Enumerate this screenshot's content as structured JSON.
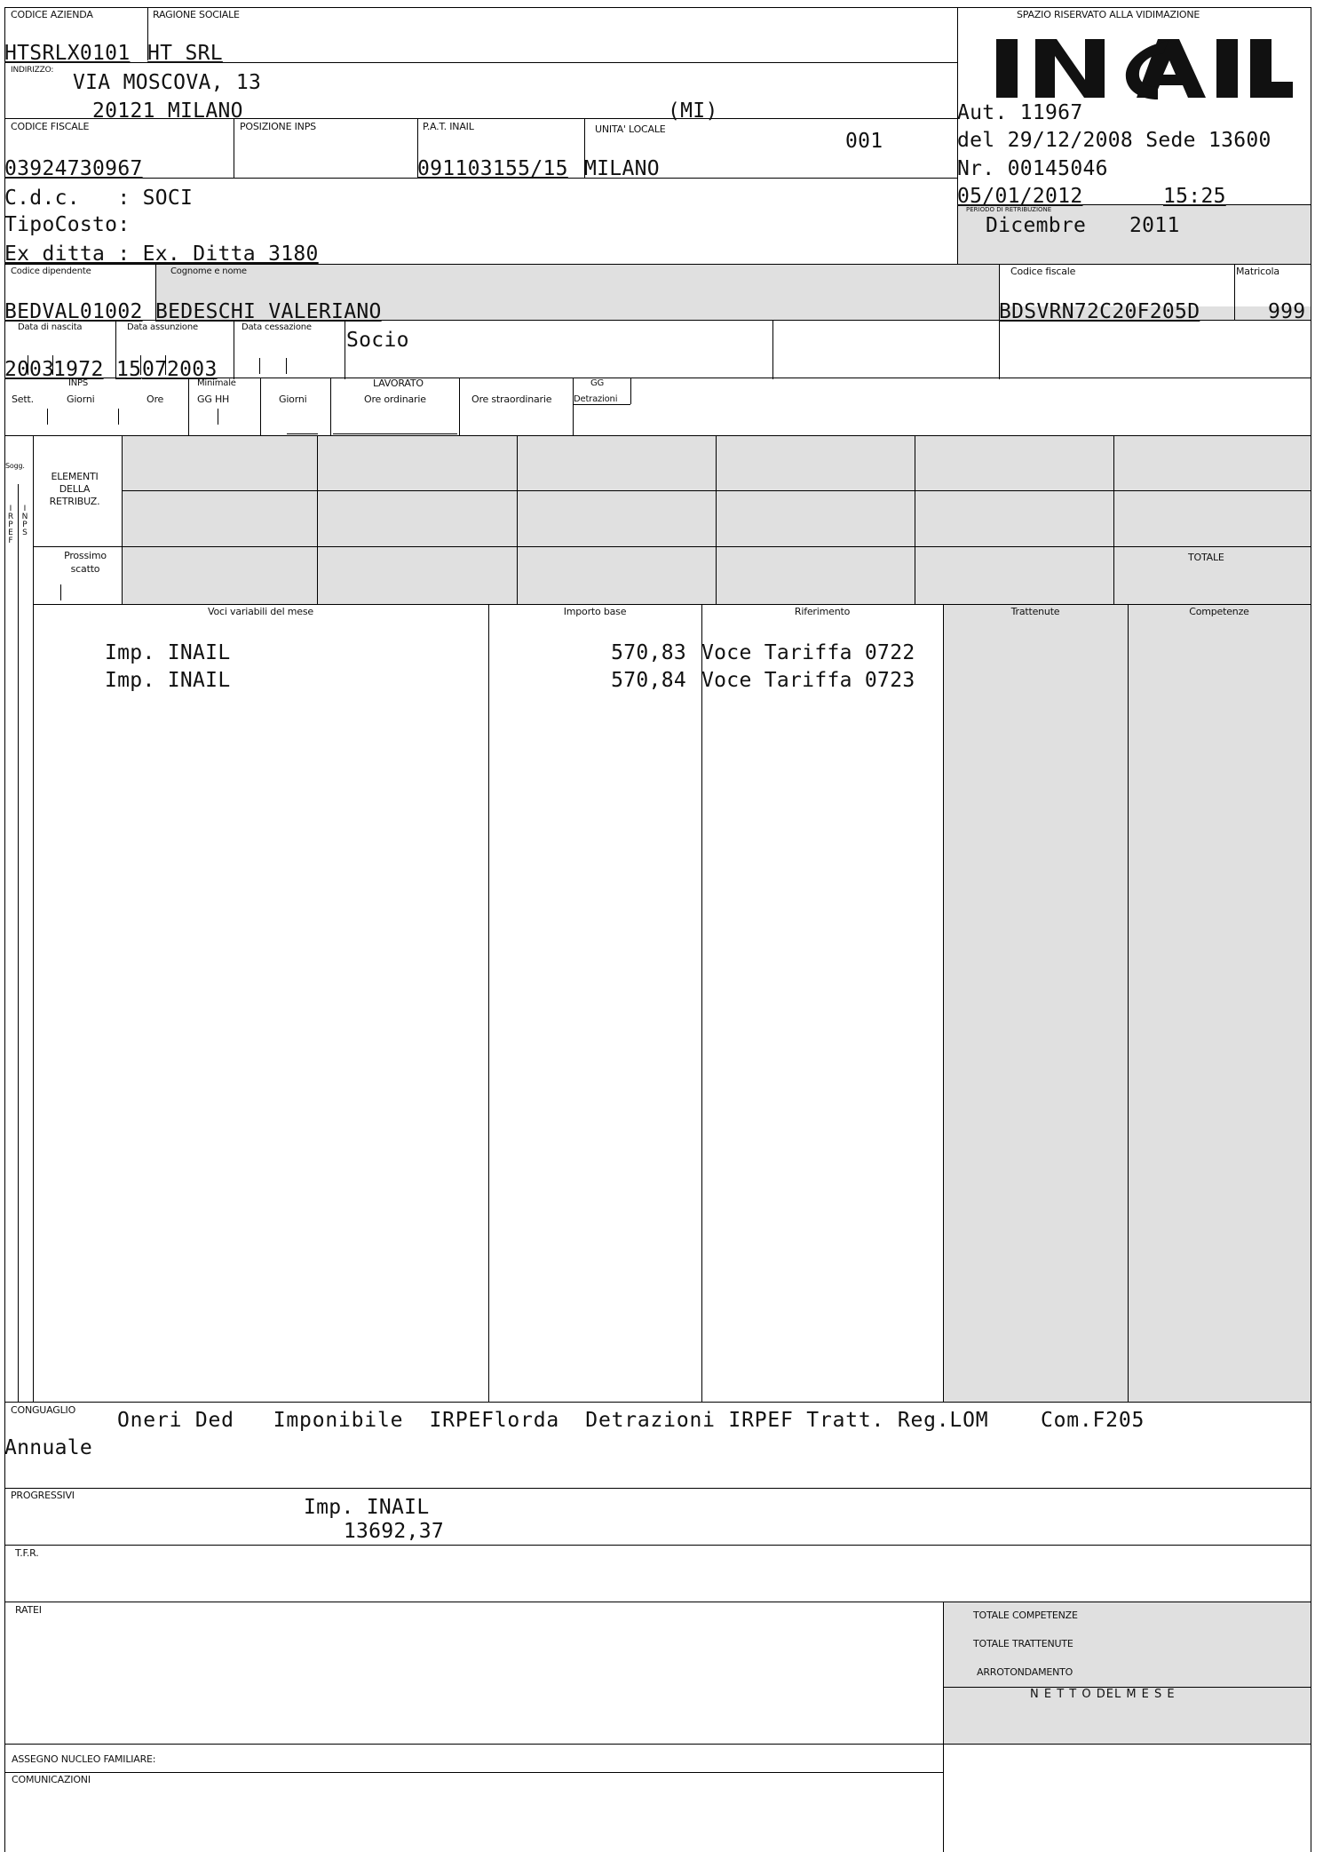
{
  "header": {
    "codice_azienda_label": "CODICE AZIENDA",
    "ragione_sociale_label": "RAGIONE SOCIALE",
    "codice_azienda": "HTSRLX0101",
    "ragione_sociale": "HT SRL",
    "indirizzo_label": "INDIRIZZO:",
    "indirizzo": "VIA MOSCOVA, 13",
    "cap_citta": "20121 MILANO",
    "provincia": "(MI)",
    "codice_fiscale_label": "CODICE FISCALE",
    "posizione_inps_label": "POSIZIONE INPS",
    "pat_inail_label": "P.A.T. INAIL",
    "unita_locale_label": "UNITA' LOCALE",
    "unita_locale_code": "001",
    "codice_fiscale": "03924730967",
    "pat_inail": "091103155/15",
    "unita_locale": "MILANO",
    "cdc": "C.d.c.   : SOCI",
    "tipo_costo": "TipoCosto:",
    "ex_ditta": "Ex ditta : Ex. Ditta 3180"
  },
  "vidimazione": {
    "label": "SPAZIO RISERVATO ALLA VIDIMAZIONE",
    "logo": "INAIL",
    "aut": "Aut. 11967",
    "del": "del 29/12/2008 Sede 13600",
    "nr": "Nr. 00145046",
    "data": "05/01/2012",
    "ora": "15:25",
    "periodo_label": "PERIODO DI RETRIBUZIONE",
    "periodo_mese": "Dicembre",
    "periodo_anno": "2011"
  },
  "employee": {
    "codice_dipendente_label": "Codice dipendente",
    "cognome_nome_label": "Cognome e nome",
    "codice_fiscale_label": "Codice fiscale",
    "matricola_label": "Matricola",
    "codice_dipendente": "BEDVAL01002",
    "cognome_nome": "BEDESCHI VALERIANO",
    "codice_fiscale": "BDSVRN72C20F205D",
    "matricola": "999",
    "data_nascita_label": "Data di nascita",
    "data_assunzione_label": "Data assunzione",
    "data_cessazione_label": "Data cessazione",
    "nascita_gg": "20",
    "nascita_mm": "03",
    "nascita_aa": "1972",
    "assunzione_gg": "15",
    "assunzione_mm": "07",
    "assunzione_aa": "2003",
    "qualifica": "Socio"
  },
  "attendance": {
    "inps_label": "INPS",
    "sett_label": "Sett.",
    "giorni_label": "Giorni",
    "ore_label": "Ore",
    "minimale_label": "Minimale",
    "gg_hh_label": "GG  HH",
    "giorni2_label": "Giorni",
    "lavorato_label": "LAVORATO",
    "ore_ordinarie_label": "Ore ordinarie",
    "ore_straordinarie_label": "Ore straordinarie",
    "gg_label": "GG",
    "detrazioni_label": "Detrazioni"
  },
  "elementi": {
    "sogg_label": "Sogg.",
    "irpef_label": "IRPEF",
    "inps_label": "INPS",
    "elementi_label": "ELEMENTI DELLA RETRIBUZ.",
    "prossimo_label": "Prossimo scatto",
    "totale_label": "TOTALE"
  },
  "voci": {
    "col_voci": "Voci variabili del mese",
    "col_importo": "Importo base",
    "col_riferimento": "Riferimento",
    "col_trattenute": "Trattenute",
    "col_competenze": "Competenze",
    "rows": [
      {
        "descr": "Imp. INAIL",
        "importo": "570,83",
        "riferimento": "Voce Tariffa 0722"
      },
      {
        "descr": "Imp. INAIL",
        "importo": "570,84",
        "riferimento": "Voce Tariffa 0723"
      }
    ]
  },
  "conguaglio": {
    "label": "CONGUAGLIO",
    "text": "Oneri Ded   Imponibile  IRPEFlorda  Detrazioni IRPEF Tratt. Reg.LOM    Com.F205",
    "text2": "Annuale"
  },
  "progressivi": {
    "label": "PROGRESSIVI",
    "voce": "Imp. INAIL",
    "valore": "13692,37"
  },
  "tfr_label": "T.F.R.",
  "ratei_label": "RATEI",
  "totali": {
    "competenze": "TOTALE COMPETENZE",
    "trattenute": "TOTALE TRATTENUTE",
    "arrotondamento": "ARROTONDAMENTO",
    "netto": "N E T T O  DEL  M E S E"
  },
  "anf_label": "ASSEGNO NUCLEO FAMILIARE:",
  "comunicazioni_label": "COMUNICAZIONI"
}
